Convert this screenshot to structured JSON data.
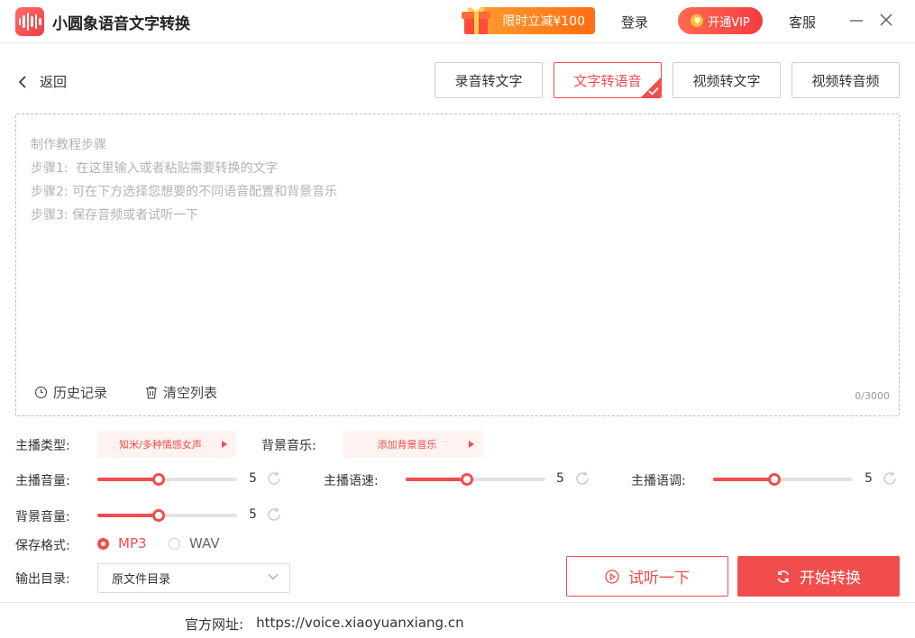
{
  "app": {
    "title": "小圆象语音文字转换",
    "promo_label": "限时立减¥100",
    "login_label": "登录",
    "vip_label": "开通VIP",
    "service_label": "客服"
  },
  "nav": {
    "back_label": "返回",
    "tabs": [
      {
        "label": "录音转文字",
        "active": false
      },
      {
        "label": "文字转语音",
        "active": true
      },
      {
        "label": "视频转文字",
        "active": false
      },
      {
        "label": "视频转音频",
        "active": false
      }
    ]
  },
  "editor": {
    "guide_lines": [
      "制作教程步骤",
      "步骤1:  在这里输入或者粘贴需要转换的文字",
      "步骤2: 可在下方选择您想要的不同语音配置和背景音乐",
      "步骤3: 保存音频或者试听一下"
    ],
    "history_label": "历史记录",
    "clear_label": "清空列表",
    "counter": "0/3000"
  },
  "settings": {
    "anchor_type_label": "主播类型:",
    "anchor_type_value": "知米/多种情感女声",
    "bgm_label": "背景音乐:",
    "bgm_value": "添加背景音乐",
    "sliders": [
      {
        "label": "主播音量:",
        "value": "5",
        "fraction": 0.44
      },
      {
        "label": "主播语速:",
        "value": "5",
        "fraction": 0.44
      },
      {
        "label": "主播语调:",
        "value": "5",
        "fraction": 0.44
      },
      {
        "label": "背景音量:",
        "value": "5",
        "fraction": 0.44
      }
    ],
    "format_label": "保存格式:",
    "formats": [
      {
        "label": "MP3",
        "selected": true
      },
      {
        "label": "WAV",
        "selected": false
      }
    ],
    "output_label": "输出目录:",
    "output_value": "原文件目录"
  },
  "actions": {
    "listen_label": "试听一下",
    "start_label": "开始转换"
  },
  "footer": {
    "site_label": "官方网址:",
    "site_url": "https://voice.xiaoyuanxiang.cn"
  },
  "colors": {
    "accent": "#f24d4d",
    "promo": "#ff7a1a"
  }
}
